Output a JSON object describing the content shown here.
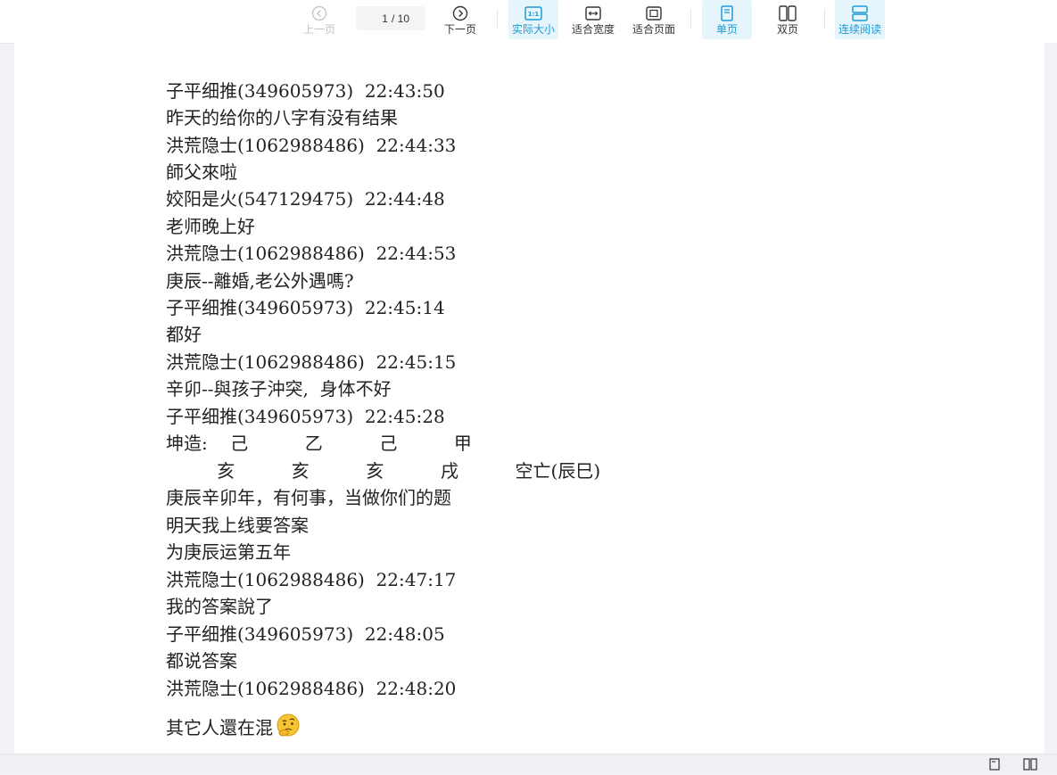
{
  "toolbar": {
    "prev_label": "上一页",
    "next_label": "下一页",
    "page_current": "1",
    "page_total": "/ 10",
    "actual_size_label": "实际大小",
    "fit_width_label": "适合宽度",
    "fit_page_label": "适合页面",
    "single_page_label": "单页",
    "double_page_label": "双页",
    "continuous_label": "连续阅读",
    "accent_color": "#1a9bd7"
  },
  "document": {
    "lines": [
      "子平细推(349605973)  22:43:50",
      "昨天的给你的八字有没有结果",
      "洪荒隐士(1062988486)  22:44:33",
      "師父來啦",
      "姣阳是火(547129475)  22:44:48",
      "老师晚上好",
      "洪荒隐士(1062988486)  22:44:53",
      "庚辰--離婚,老公外遇嗎?",
      "子平细推(349605973)  22:45:14",
      "都好",
      "洪荒隐士(1062988486)  22:45:15",
      "辛卯--與孩子沖突,  身体不好",
      "子平细推(349605973)  22:45:28",
      "坤造:    己          乙          己          甲",
      "         亥          亥          亥          戌          空亡(辰巳)",
      "庚辰辛卯年，有何事，当做你们的题",
      "明天我上线要答案",
      "为庚辰运第五年",
      "洪荒隐士(1062988486)  22:47:17",
      "我的答案說了",
      "子平细推(349605973)  22:48:05",
      "都说答案",
      "洪荒隐士(1062988486)  22:48:20",
      "其它人還在混"
    ]
  }
}
